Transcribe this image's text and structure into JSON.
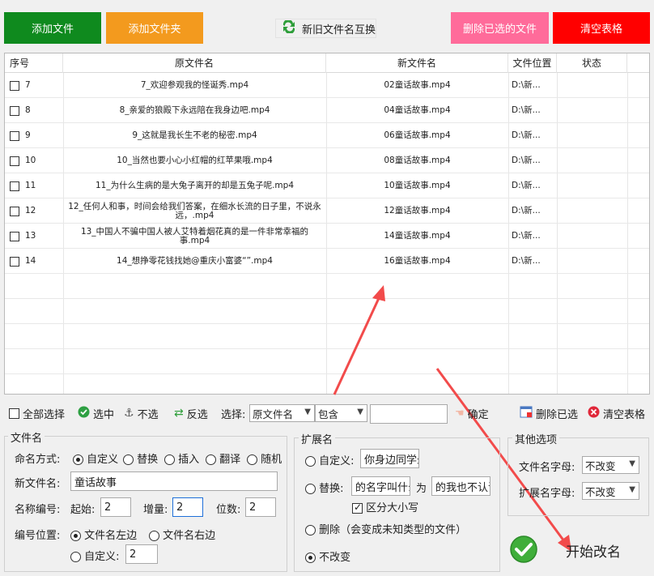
{
  "toolbar": {
    "add_file": "添加文件",
    "add_folder": "添加文件夹",
    "swap_names": "新旧文件名互换",
    "delete_selected_files": "删除已选的文件",
    "clear_table": "清空表格",
    "colors": {
      "green": "#0f8a1e",
      "orange": "#f39a1e",
      "pink": "#ff6b9a",
      "red": "#ff0000"
    }
  },
  "table": {
    "headers": [
      "序号",
      "原文件名",
      "新文件名",
      "文件位置",
      "状态"
    ],
    "rows": [
      {
        "no": "7",
        "original": "7_欢迎参观我的怪诞秀.mp4",
        "new": "02童话故事.mp4",
        "location": "D:\\新...",
        "status": ""
      },
      {
        "no": "8",
        "original": "8_亲爱的狼殿下永远陪在我身边吧.mp4",
        "new": "04童话故事.mp4",
        "location": "D:\\新...",
        "status": ""
      },
      {
        "no": "9",
        "original": "9_这就是我长生不老的秘密.mp4",
        "new": "06童话故事.mp4",
        "location": "D:\\新...",
        "status": ""
      },
      {
        "no": "10",
        "original": "10_当然也要小心小红帽的红苹果哦.mp4",
        "new": "08童话故事.mp4",
        "location": "D:\\新...",
        "status": ""
      },
      {
        "no": "11",
        "original": "11_为什么生病的是大兔子离开的却是五兔子呢.mp4",
        "new": "10童话故事.mp4",
        "location": "D:\\新...",
        "status": ""
      },
      {
        "no": "12",
        "original": "12_任何人和事，时间会给我们答案，在细水长流的日子里，不说永远，.mp4",
        "new": "12童话故事.mp4",
        "location": "D:\\新...",
        "status": ""
      },
      {
        "no": "13",
        "original": "13_中国人不骗中国人被人艾特着烟花真的是一件非常幸福的事.mp4",
        "new": "14童话故事.mp4",
        "location": "D:\\新...",
        "status": ""
      },
      {
        "no": "14",
        "original": "14_想挣零花钱找她@重庆小富婆“”.mp4",
        "new": "16童话故事.mp4",
        "location": "D:\\新...",
        "status": ""
      }
    ]
  },
  "selection_bar": {
    "select_all": "全部选择",
    "check": "选中",
    "uncheck": "不选",
    "invert": "反选",
    "select_label": "选择:",
    "field_value": "原文件名",
    "match_value": "包含",
    "filter_text": "",
    "confirm": "确定",
    "delete_selected": "删除已选",
    "clear_table": "清空表格"
  },
  "filename_panel": {
    "title": "文件名",
    "mode_label": "命名方式:",
    "modes": [
      "自定义",
      "替换",
      "插入",
      "翻译",
      "随机"
    ],
    "new_name_label": "新文件名:",
    "new_name_value": "童话故事",
    "numbering_label": "名称编号:",
    "start_label": "起始:",
    "start_value": "2",
    "increment_label": "增量:",
    "increment_value": "2",
    "digits_label": "位数:",
    "digits_value": "2",
    "position_label": "编号位置:",
    "position_left": "文件名左边",
    "position_right": "文件名右边",
    "position_custom": "自定义:",
    "position_custom_value": "2"
  },
  "extension_panel": {
    "title": "扩展名",
    "custom_label": "自定义:",
    "custom_value": "你身边同学最",
    "replace_label": "替换:",
    "replace_from": "的名字叫什么",
    "replace_to_label": "为",
    "replace_to": "的我也不认识",
    "case_sensitive": "区分大小写",
    "delete_label": "删除（会变成未知类型的文件）",
    "keep_label": "不改变"
  },
  "other_panel": {
    "title": "其他选项",
    "filename_case_label": "文件名字母:",
    "filename_case_value": "不改变",
    "ext_case_label": "扩展名字母:",
    "ext_case_value": "不改变"
  },
  "start_button": {
    "label": "开始改名"
  }
}
